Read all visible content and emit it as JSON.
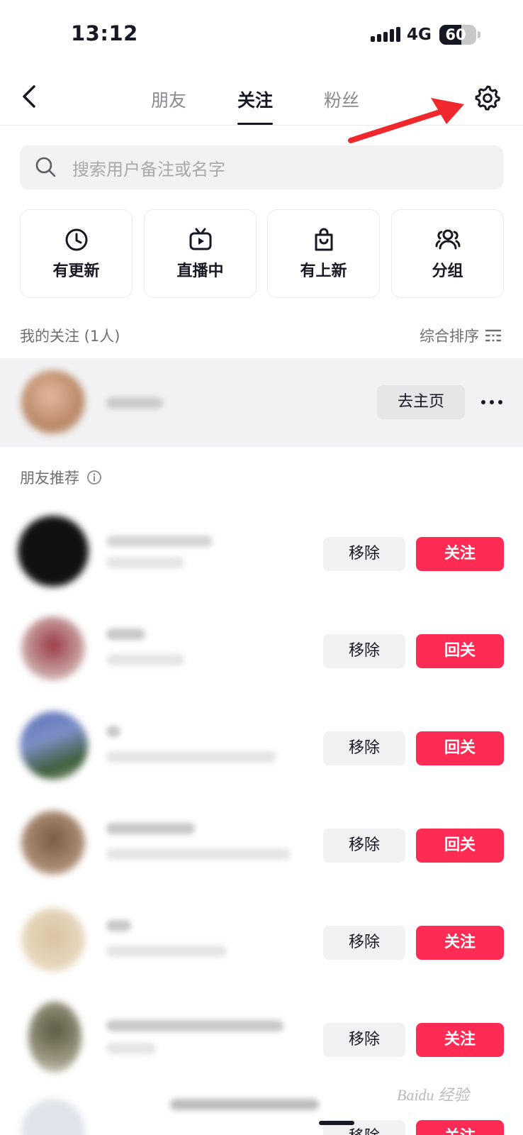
{
  "status_bar": {
    "time": "13:12",
    "network": "4G",
    "battery": "60",
    "battery_level": 0.6
  },
  "nav": {
    "tabs": [
      {
        "label": "朋友",
        "active": false
      },
      {
        "label": "关注",
        "active": true
      },
      {
        "label": "粉丝",
        "active": false
      }
    ],
    "back_icon": "chevron-left-icon",
    "settings_icon": "gear-icon",
    "annotation_color": "#f0282d"
  },
  "search": {
    "placeholder": "搜索用户备注或名字",
    "icon": "search-icon"
  },
  "quick_actions": [
    {
      "label": "有更新",
      "icon": "clock-icon"
    },
    {
      "label": "直播中",
      "icon": "tv-play-icon"
    },
    {
      "label": "有上新",
      "icon": "shopping-bag-icon"
    },
    {
      "label": "分组",
      "icon": "group-icon"
    }
  ],
  "my_follow": {
    "title": "我的关注 (1人)",
    "sort_label": "综合排序",
    "items": [
      {
        "action_label": "去主页"
      }
    ]
  },
  "recommend": {
    "title": "朋友推荐",
    "items": [
      {
        "remove_label": "移除",
        "follow_label": "关注"
      },
      {
        "remove_label": "移除",
        "follow_label": "回关"
      },
      {
        "remove_label": "移除",
        "follow_label": "回关"
      },
      {
        "remove_label": "移除",
        "follow_label": "回关"
      },
      {
        "remove_label": "移除",
        "follow_label": "关注"
      },
      {
        "remove_label": "移除",
        "follow_label": "关注"
      },
      {
        "remove_label": "移除",
        "follow_label": "关注"
      }
    ]
  },
  "colors": {
    "accent": "#fe2c55",
    "text": "#161823",
    "muted": "#8a8b91",
    "surface": "#f2f2f4"
  },
  "watermark": "Baidu 经验"
}
